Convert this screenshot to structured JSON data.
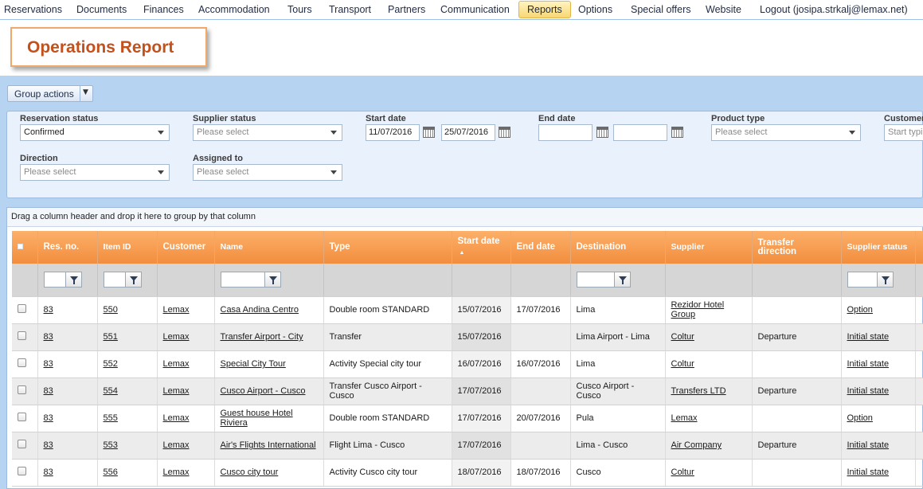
{
  "nav": {
    "items": [
      "Reservations",
      "Documents",
      "Finances",
      "Accommodation",
      "Tours",
      "Transport",
      "Partners",
      "Communication",
      "Reports",
      "Options",
      "Special offers",
      "Website",
      "Logout (josipa.strkalj@lemax.net)"
    ],
    "active": "Reports"
  },
  "page": {
    "title": "Operations Report"
  },
  "toolbar": {
    "group_actions_label": "Group actions"
  },
  "filters": {
    "reservation_status": {
      "label": "Reservation status",
      "value": "Confirmed"
    },
    "supplier_status": {
      "label": "Supplier status",
      "placeholder": "Please select"
    },
    "start_date": {
      "label": "Start date",
      "from": "11/07/2016",
      "to": "25/07/2016"
    },
    "end_date": {
      "label": "End date",
      "from": "",
      "to": ""
    },
    "product_type": {
      "label": "Product type",
      "placeholder": "Please select"
    },
    "customer": {
      "label": "Customer",
      "placeholder": "Start typing"
    },
    "direction": {
      "label": "Direction",
      "placeholder": "Please select"
    },
    "assigned_to": {
      "label": "Assigned to",
      "placeholder": "Please select"
    }
  },
  "grid": {
    "drop_hint": "Drag a column header and drop it here to group by that column",
    "columns": [
      "Res. no.",
      "Item ID",
      "Customer",
      "Name",
      "Type",
      "Start date",
      "End date",
      "Destination",
      "Supplier",
      "Transfer direction",
      "Supplier status"
    ],
    "rows": [
      {
        "res_no": "83",
        "item_id": "550",
        "customer": "Lemax",
        "name": "Casa Andina Centro",
        "type": "Double room STANDARD",
        "start": "15/07/2016",
        "end": "17/07/2016",
        "destination": "Lima",
        "supplier": "Rezidor Hotel Group",
        "direction": "",
        "status": "Option"
      },
      {
        "res_no": "83",
        "item_id": "551",
        "customer": "Lemax",
        "name": "Transfer Airport - City",
        "type": "Transfer",
        "start": "15/07/2016",
        "end": "",
        "destination": "Lima Airport - Lima",
        "supplier": "Coltur",
        "direction": "Departure",
        "status": "Initial state"
      },
      {
        "res_no": "83",
        "item_id": "552",
        "customer": "Lemax",
        "name": "Special City Tour",
        "type": "Activity Special city tour",
        "start": "16/07/2016",
        "end": "16/07/2016",
        "destination": "Lima",
        "supplier": "Coltur",
        "direction": "",
        "status": "Initial state"
      },
      {
        "res_no": "83",
        "item_id": "554",
        "customer": "Lemax",
        "name": "Cusco Airport - Cusco",
        "type": "Transfer Cusco Airport - Cusco",
        "start": "17/07/2016",
        "end": "",
        "destination": "Cusco Airport - Cusco",
        "supplier": "Transfers LTD",
        "direction": "Departure",
        "status": "Initial state"
      },
      {
        "res_no": "83",
        "item_id": "555",
        "customer": "Lemax",
        "name": "Guest house Hotel Riviera",
        "type": "Double room STANDARD",
        "start": "17/07/2016",
        "end": "20/07/2016",
        "destination": "Pula",
        "supplier": "Lemax",
        "direction": "",
        "status": "Option"
      },
      {
        "res_no": "83",
        "item_id": "553",
        "customer": "Lemax",
        "name": "Air's Flights International",
        "type": "Flight Lima - Cusco",
        "start": "17/07/2016",
        "end": "",
        "destination": "Lima - Cusco",
        "supplier": "Air Company",
        "direction": "Departure",
        "status": "Initial state"
      },
      {
        "res_no": "83",
        "item_id": "556",
        "customer": "Lemax",
        "name": "Cusco city tour",
        "type": "Activity Cusco city tour",
        "start": "18/07/2016",
        "end": "18/07/2016",
        "destination": "Cusco",
        "supplier": "Coltur",
        "direction": "",
        "status": "Initial state"
      }
    ]
  }
}
